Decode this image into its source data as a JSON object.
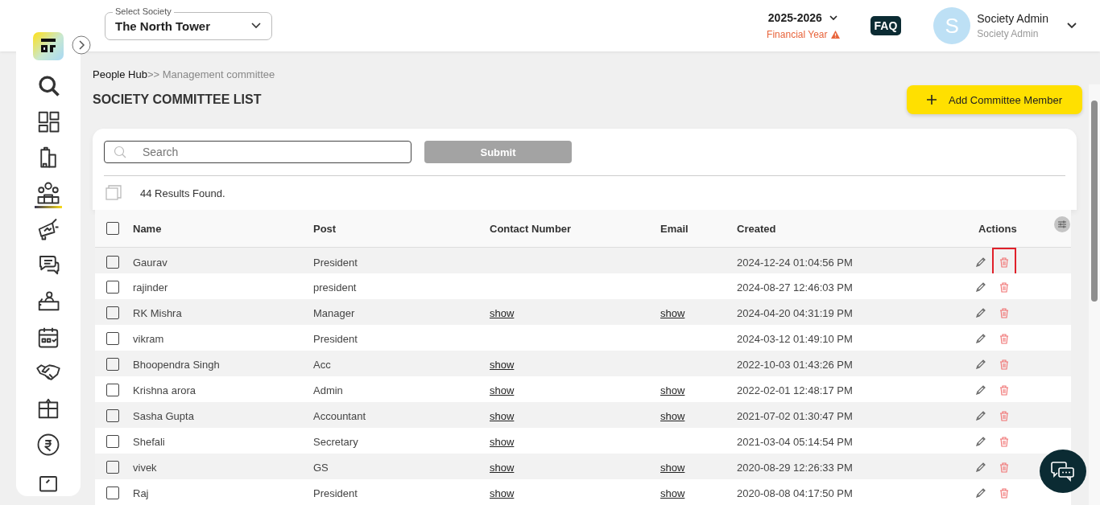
{
  "sidebar": {
    "items": [
      {
        "selected": false
      },
      {
        "selected": false
      },
      {
        "selected": false
      },
      {
        "selected": true
      },
      {
        "selected": false
      },
      {
        "selected": false
      },
      {
        "selected": false
      },
      {
        "selected": false
      },
      {
        "selected": false
      },
      {
        "selected": false
      },
      {
        "selected": false
      },
      {
        "selected": false
      }
    ]
  },
  "header": {
    "society_label": "Select Society",
    "society_value": "The North Tower",
    "year": "2025-2026",
    "year_note": "Financial Year",
    "faq": "FAQ",
    "avatar_letter": "S",
    "user_name": "Society Admin",
    "user_role": "Society Admin"
  },
  "breadcrumb": {
    "parent": "People Hub",
    "separator": ">>",
    "current": "Management committee"
  },
  "page_title": "SOCIETY COMMITTEE LIST",
  "add_button": "Add Committee Member",
  "search": {
    "placeholder": "Search",
    "submit": "Submit"
  },
  "results": "44 Results Found.",
  "table": {
    "all_checked": false,
    "columns": [
      "Name",
      "Post",
      "Contact Number",
      "Email",
      "Created",
      "Actions"
    ],
    "rows": [
      {
        "checked": false,
        "name": "Gaurav",
        "post": "President",
        "contact": "",
        "email": "",
        "created": "2024-12-24 01:04:56 PM",
        "delete_highlighted": true
      },
      {
        "checked": false,
        "name": "rajinder",
        "post": "president",
        "contact": "",
        "email": "",
        "created": "2024-08-27 12:46:03 PM",
        "delete_highlighted": false
      },
      {
        "checked": false,
        "name": "RK Mishra",
        "post": "Manager",
        "contact": "show",
        "email": "show",
        "created": "2024-04-20 04:31:19 PM",
        "delete_highlighted": false
      },
      {
        "checked": false,
        "name": "vikram",
        "post": "President",
        "contact": "",
        "email": "",
        "created": "2024-03-12 01:49:10 PM",
        "delete_highlighted": false
      },
      {
        "checked": false,
        "name": "Bhoopendra Singh",
        "post": "Acc",
        "contact": "show",
        "email": "",
        "created": "2022-10-03 01:43:26 PM",
        "delete_highlighted": false
      },
      {
        "checked": false,
        "name": "Krishna arora",
        "post": "Admin",
        "contact": "show",
        "email": "show",
        "created": "2022-02-01 12:48:17 PM",
        "delete_highlighted": false
      },
      {
        "checked": false,
        "name": "Sasha Gupta",
        "post": "Accountant",
        "contact": "show",
        "email": "show",
        "created": "2021-07-02 01:30:47 PM",
        "delete_highlighted": false
      },
      {
        "checked": false,
        "name": "Shefali",
        "post": "Secretary",
        "contact": "show",
        "email": "",
        "created": "2021-03-04 05:14:54 PM",
        "delete_highlighted": false
      },
      {
        "checked": false,
        "name": "vivek",
        "post": "GS",
        "contact": "show",
        "email": "show",
        "created": "2020-08-29 12:26:33 PM",
        "delete_highlighted": false
      },
      {
        "checked": false,
        "name": "Raj",
        "post": "President",
        "contact": "show",
        "email": "show",
        "created": "2020-08-08 04:17:50 PM",
        "delete_highlighted": false
      }
    ]
  }
}
